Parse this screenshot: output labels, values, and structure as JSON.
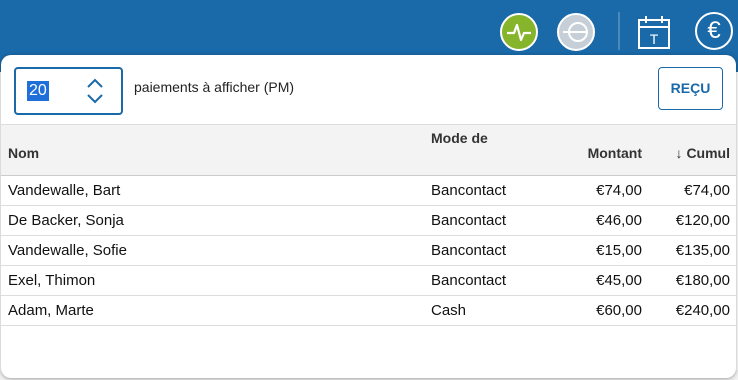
{
  "header": {
    "icons": [
      "pulse-icon",
      "coin-icon",
      "calendar-icon",
      "euro-icon"
    ],
    "calendar_letter": "T",
    "euro_symbol": "€",
    "accent": "#1a69a8",
    "pulse_color": "#86b52c"
  },
  "controls": {
    "count_value": "20",
    "count_label": "paiements à afficher (PM)",
    "receipt_button": "REÇU"
  },
  "table": {
    "columns": {
      "name": "Nom",
      "mode": "Mode de",
      "amount": "Montant",
      "sort_arrow": "↓",
      "cumulative": "Cumul"
    },
    "rows": [
      {
        "name": "Vandewalle, Bart",
        "mode": "Bancontact",
        "amount": "€74,00",
        "cumulative": "€74,00"
      },
      {
        "name": "De Backer, Sonja",
        "mode": "Bancontact",
        "amount": "€46,00",
        "cumulative": "€120,00"
      },
      {
        "name": "Vandewalle, Sofie",
        "mode": "Bancontact",
        "amount": "€15,00",
        "cumulative": "€135,00"
      },
      {
        "name": "Exel, Thimon",
        "mode": "Bancontact",
        "amount": "€45,00",
        "cumulative": "€180,00"
      },
      {
        "name": "Adam, Marte",
        "mode": "Cash",
        "amount": "€60,00",
        "cumulative": "€240,00"
      }
    ]
  }
}
